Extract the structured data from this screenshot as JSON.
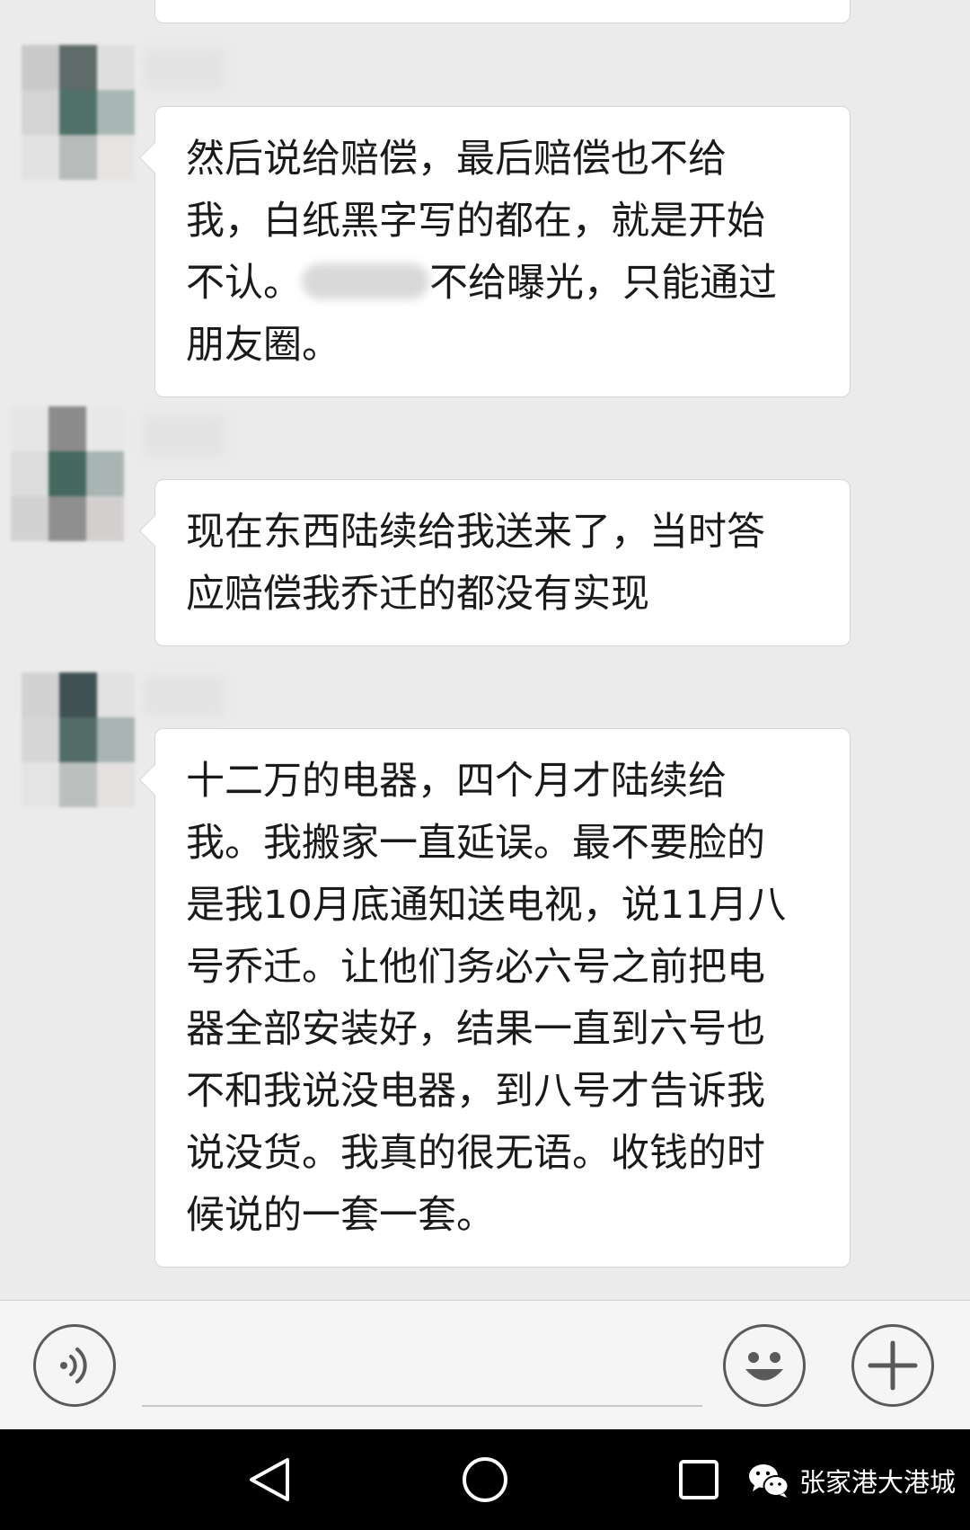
{
  "chat": {
    "messages": [
      {
        "lines": [
          "然后说给赔偿，最后赔偿也不给",
          "我，白纸黑字写的都在，就是开始"
        ],
        "line3_before": "不认。",
        "line3_after": "不给曝光，只能通过",
        "line4": "朋友圈。"
      },
      {
        "lines": [
          "现在东西陆续给我送来了，当时答",
          "应赔偿我乔迁的都没有实现"
        ]
      },
      {
        "lines": [
          "十二万的电器，四个月才陆续给",
          "我。我搬家一直延误。最不要脸的",
          "是我10月底通知送电视，说11月八",
          "号乔迁。让他们务必六号之前把电",
          "器全部安装好，结果一直到六号也",
          "不和我说没电器，到八号才告诉我",
          "说没货。我真的很无语。收钱的时",
          "候说的一套一套。"
        ]
      }
    ]
  },
  "input_bar": {
    "voice_icon": "voice-icon",
    "emoji_icon": "smiley-emoji-icon",
    "plus_icon": "plus-icon"
  },
  "nav_bar": {
    "back_icon": "back-triangle-icon",
    "home_icon": "home-circle-icon",
    "recent_icon": "recent-apps-square-icon"
  },
  "watermark": {
    "text": "张家港大港城",
    "icon": "wechat-logo-icon"
  },
  "colors": {
    "chat_background": "#ebebeb",
    "bubble": "#ffffff",
    "nav_bar": "#000000"
  }
}
